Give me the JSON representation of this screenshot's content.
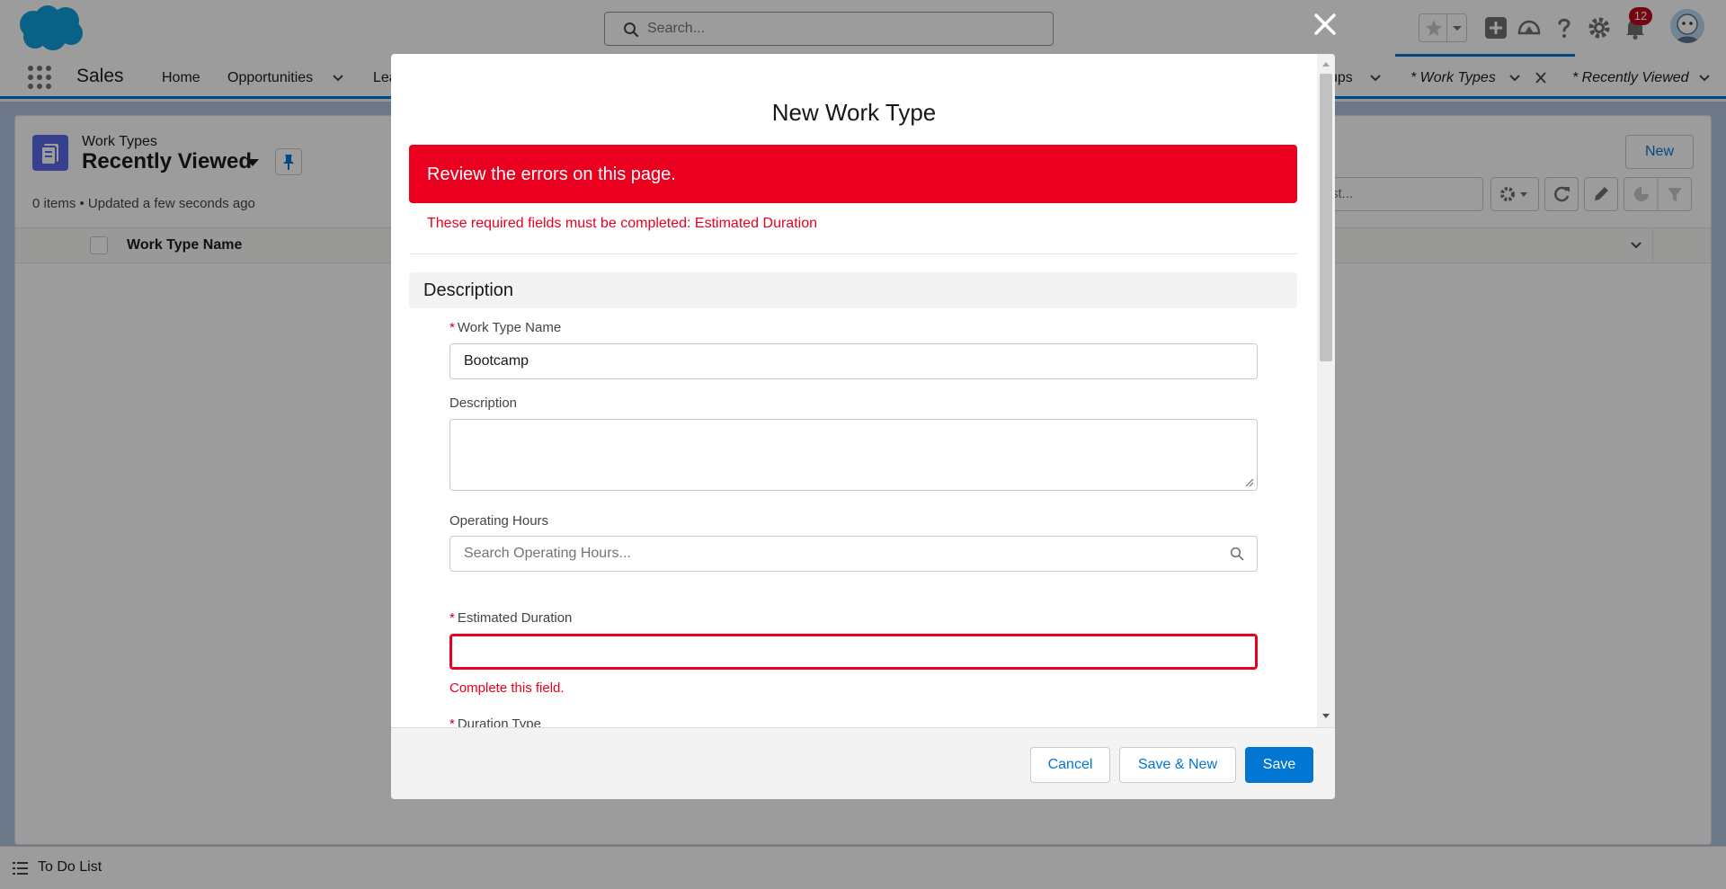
{
  "header": {
    "search_placeholder": "Search...",
    "notification_count": "12",
    "brand_color": "#0176d3"
  },
  "nav": {
    "app_name": "Sales",
    "items": [
      "Home",
      "Opportunities",
      "Lea",
      "ups"
    ],
    "workspace_tabs": [
      "* Work Types",
      "* Recently Viewed"
    ]
  },
  "list": {
    "object_label": "Work Types",
    "title": "Recently Viewed",
    "meta": "0 items • Updated a few seconds ago",
    "new_button": "New",
    "search_placeholder": "Search this list...",
    "search_visible": "st...",
    "column_header": "Work Type Name"
  },
  "modal": {
    "title": "New Work Type",
    "error_banner": "Review the errors on this page.",
    "error_message": "These required fields must be completed: Estimated Duration",
    "section_title": "Description",
    "fields": {
      "work_type_name": {
        "label": "Work Type Name",
        "value": "Bootcamp",
        "required": true
      },
      "description": {
        "label": "Description",
        "value": ""
      },
      "operating_hours": {
        "label": "Operating Hours",
        "placeholder": "Search Operating Hours..."
      },
      "estimated_duration": {
        "label": "Estimated Duration",
        "value": "",
        "error": "Complete this field.",
        "required": true
      },
      "duration_type": {
        "label": "Duration Type",
        "required": true
      }
    },
    "required_marker": "*",
    "buttons": {
      "cancel": "Cancel",
      "save_new": "Save & New",
      "save": "Save"
    }
  },
  "utility_bar": {
    "todo": "To Do List"
  }
}
